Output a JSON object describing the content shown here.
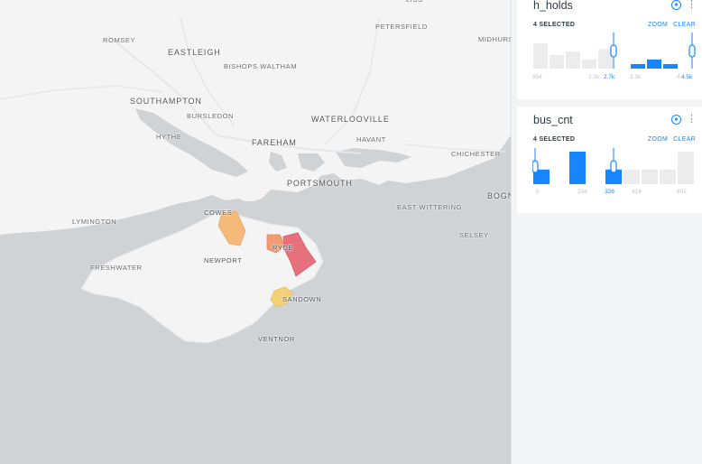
{
  "map": {
    "places": [
      {
        "label": "LISS",
        "cls": "place"
      },
      {
        "label": "ROMSEY",
        "cls": "place"
      },
      {
        "label": "EASTLEIGH",
        "cls": "place big"
      },
      {
        "label": "PETERSFIELD",
        "cls": "place"
      },
      {
        "label": "MIDHURST",
        "cls": "place"
      },
      {
        "label": "BISHOPS WALTHAM",
        "cls": "place"
      },
      {
        "label": "SOUTHAMPTON",
        "cls": "place big"
      },
      {
        "label": "BURSLEDON",
        "cls": "place"
      },
      {
        "label": "WATERLOOVILLE",
        "cls": "place big"
      },
      {
        "label": "HYTHE",
        "cls": "place"
      },
      {
        "label": "FAREHAM",
        "cls": "place big"
      },
      {
        "label": "HAVANT",
        "cls": "place"
      },
      {
        "label": "CHICHESTER",
        "cls": "place"
      },
      {
        "label": "PORTSMOUTH",
        "cls": "place big"
      },
      {
        "label": "BOGN",
        "cls": "place big"
      },
      {
        "label": "EAST WITTERING",
        "cls": "place"
      },
      {
        "label": "COWES",
        "cls": "place island"
      },
      {
        "label": "LYMINGTON",
        "cls": "place"
      },
      {
        "label": "SELSEY",
        "cls": "place"
      },
      {
        "label": "RYDE",
        "cls": "place island"
      },
      {
        "label": "NEWPORT",
        "cls": "place island"
      },
      {
        "label": "FRESHWATER",
        "cls": "place"
      },
      {
        "label": "SANDOWN",
        "cls": "place island"
      },
      {
        "label": "VENTNOR",
        "cls": "place island"
      }
    ],
    "colors": {
      "sea": "#cfd3d6",
      "land": "#f4f4f4",
      "cowes": "#f5b97a",
      "ryde_left": "#f19a73",
      "ryde_right": "#e6717d",
      "sandown": "#f3d179"
    }
  },
  "widgets": [
    {
      "title": "h_holds",
      "selected": "4 SELECTED",
      "zoom": "ZOOM",
      "clear": "CLEAR",
      "bars": [
        0.78,
        0.42,
        0.53,
        0.28,
        0.6,
        0.0,
        0.14,
        0.28,
        0.14,
        0.0
      ],
      "selected_bars": [
        false,
        false,
        false,
        false,
        false,
        false,
        true,
        true,
        true,
        false
      ],
      "ticks": [
        "954",
        "2.1k",
        "2.7k",
        "3.3k",
        "4",
        "4.5k"
      ],
      "active_ticks": [
        false,
        false,
        true,
        false,
        false,
        true
      ]
    },
    {
      "title": "bus_cnt",
      "selected": "4 SELECTED",
      "zoom": "ZOOM",
      "clear": "CLEAR",
      "bars": [
        0.45,
        0.0,
        1.0,
        0.0,
        0.45,
        0.45,
        0.45,
        0.45,
        1.0
      ],
      "selected_bars": [
        true,
        false,
        true,
        false,
        true,
        false,
        false,
        false,
        false
      ],
      "ticks": [
        "0",
        "234",
        "326",
        "418",
        "602"
      ],
      "active_ticks": [
        false,
        false,
        true,
        false,
        false
      ]
    }
  ],
  "accent": "#1785fb",
  "muted_bar": "#ececec"
}
